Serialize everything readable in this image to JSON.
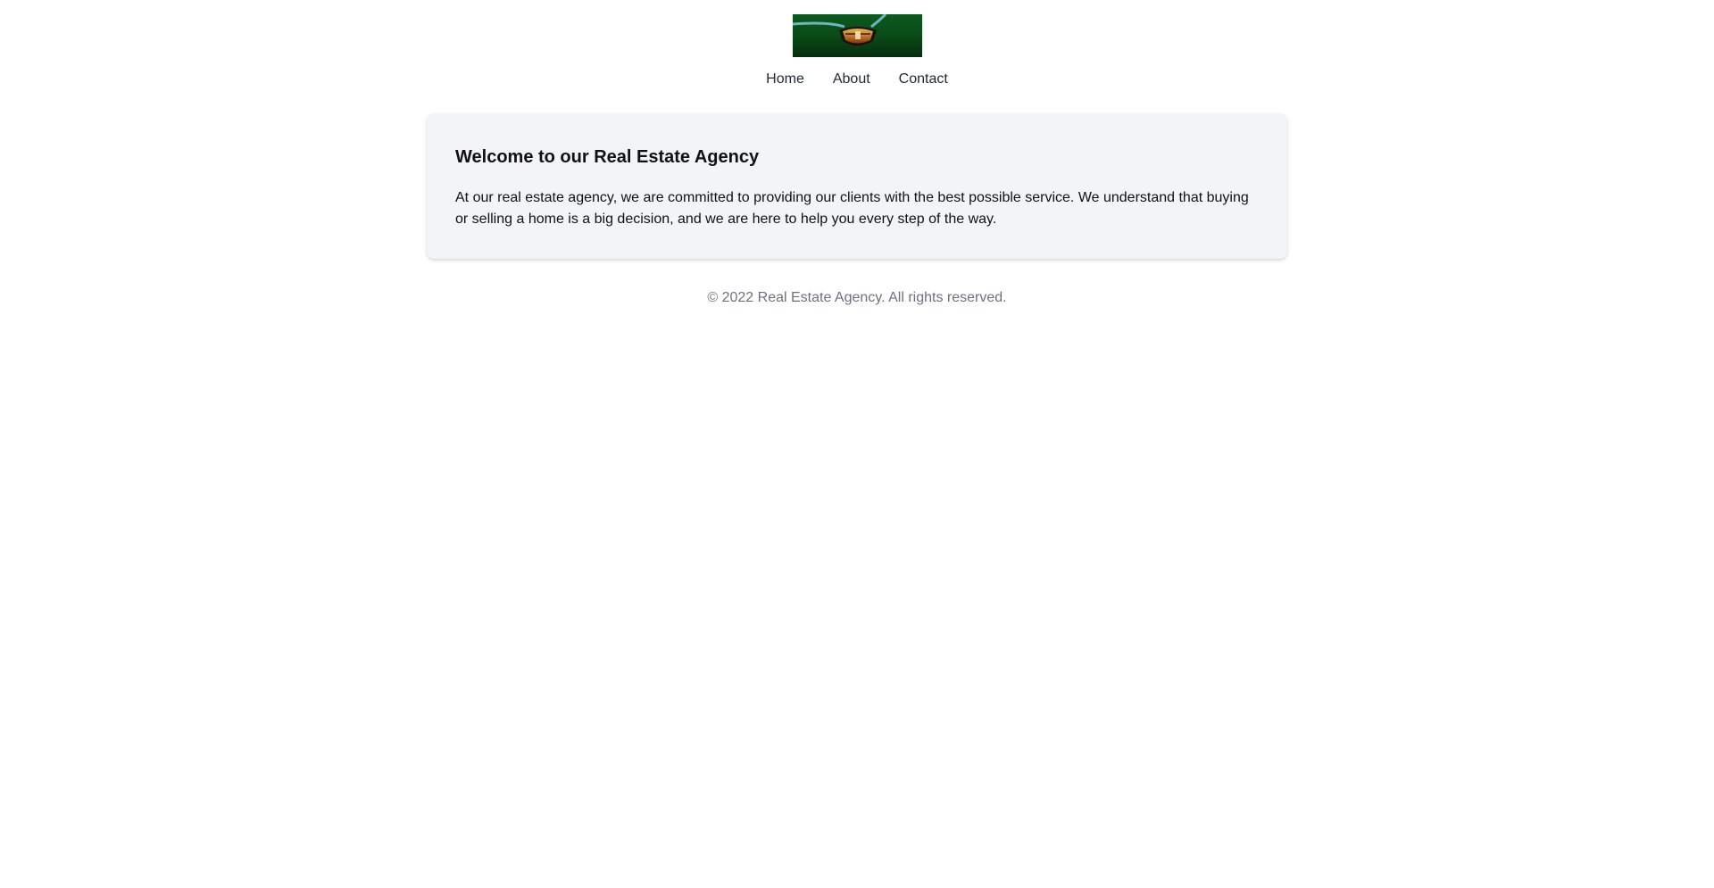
{
  "nav": {
    "items": [
      {
        "label": "Home"
      },
      {
        "label": "About"
      },
      {
        "label": "Contact"
      }
    ]
  },
  "hero": {
    "title": "Welcome to our Real Estate Agency",
    "body": "At our real estate agency, we are committed to providing our clients with the best possible service. We understand that buying or selling a home is a big decision, and we are here to help you every step of the way."
  },
  "footer": {
    "copyright": "© 2022 Real Estate Agency. All rights reserved."
  },
  "colors": {
    "card_background": "#f3f4f6",
    "nav_text": "#1f2937",
    "footer_text": "#6b7280",
    "logo_background": "#0a3f14"
  },
  "icons": {
    "logo": "crest-logo-icon"
  }
}
